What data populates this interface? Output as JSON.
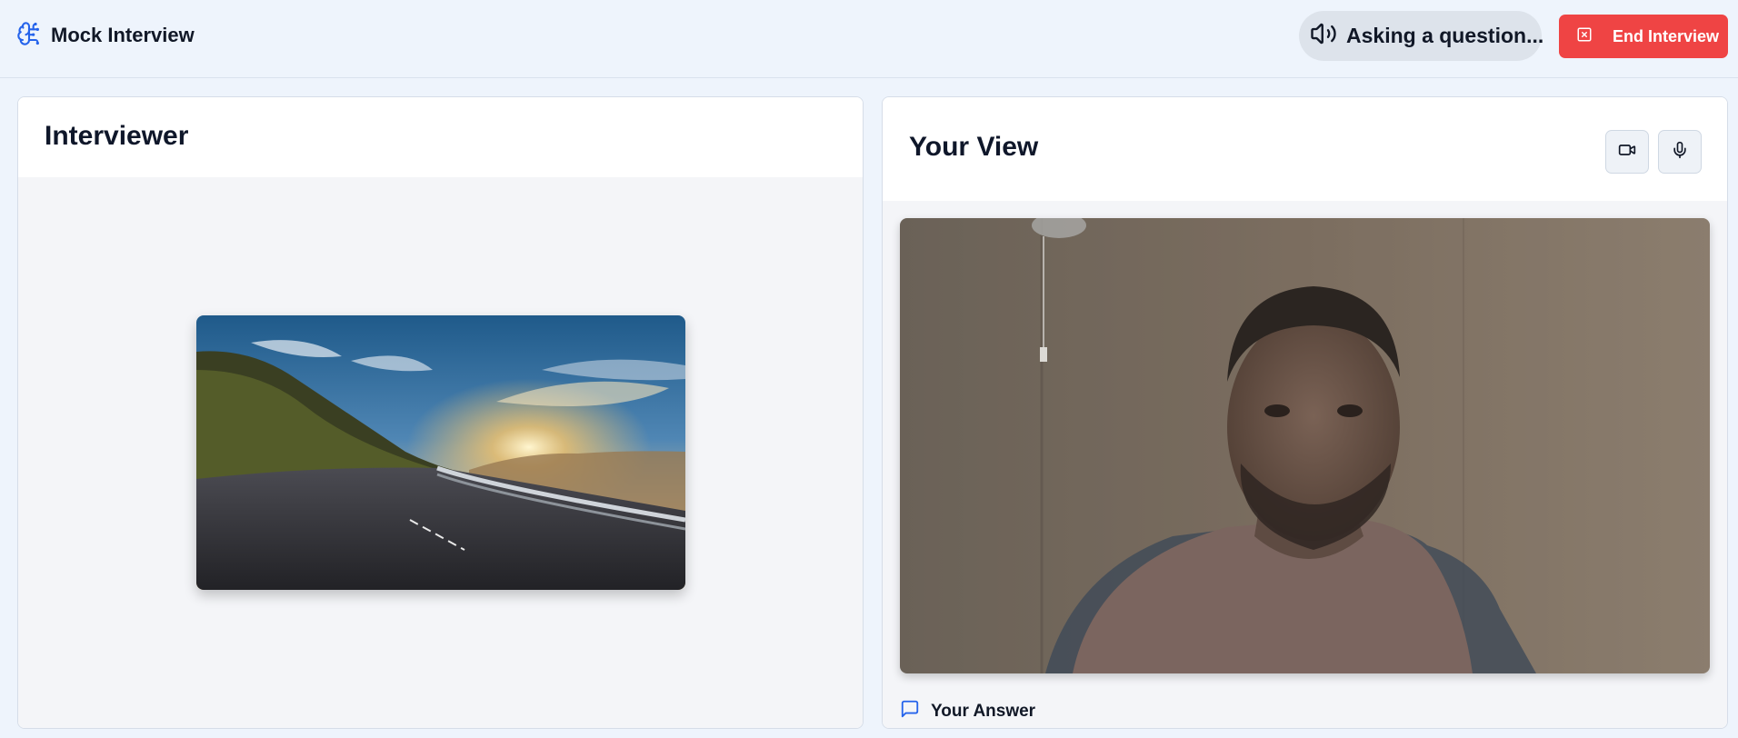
{
  "app": {
    "title": "Mock Interview",
    "brand_icon": "brain-icon"
  },
  "header": {
    "status_text": "Asking a question...",
    "status_icon": "speaker-icon",
    "end_button_label": "End Interview",
    "end_button_icon": "x-square-icon",
    "end_button_color": "#ef4444",
    "accent_color": "#2563eb"
  },
  "interviewer_panel": {
    "title": "Interviewer",
    "image": "mountain-road-sunset-photo"
  },
  "user_panel": {
    "title": "Your View",
    "camera_button_icon": "video-camera-icon",
    "mic_button_icon": "microphone-icon",
    "video_feed": "webcam-live-feed",
    "answer_label": "Your Answer",
    "answer_icon": "chat-bubble-icon"
  }
}
